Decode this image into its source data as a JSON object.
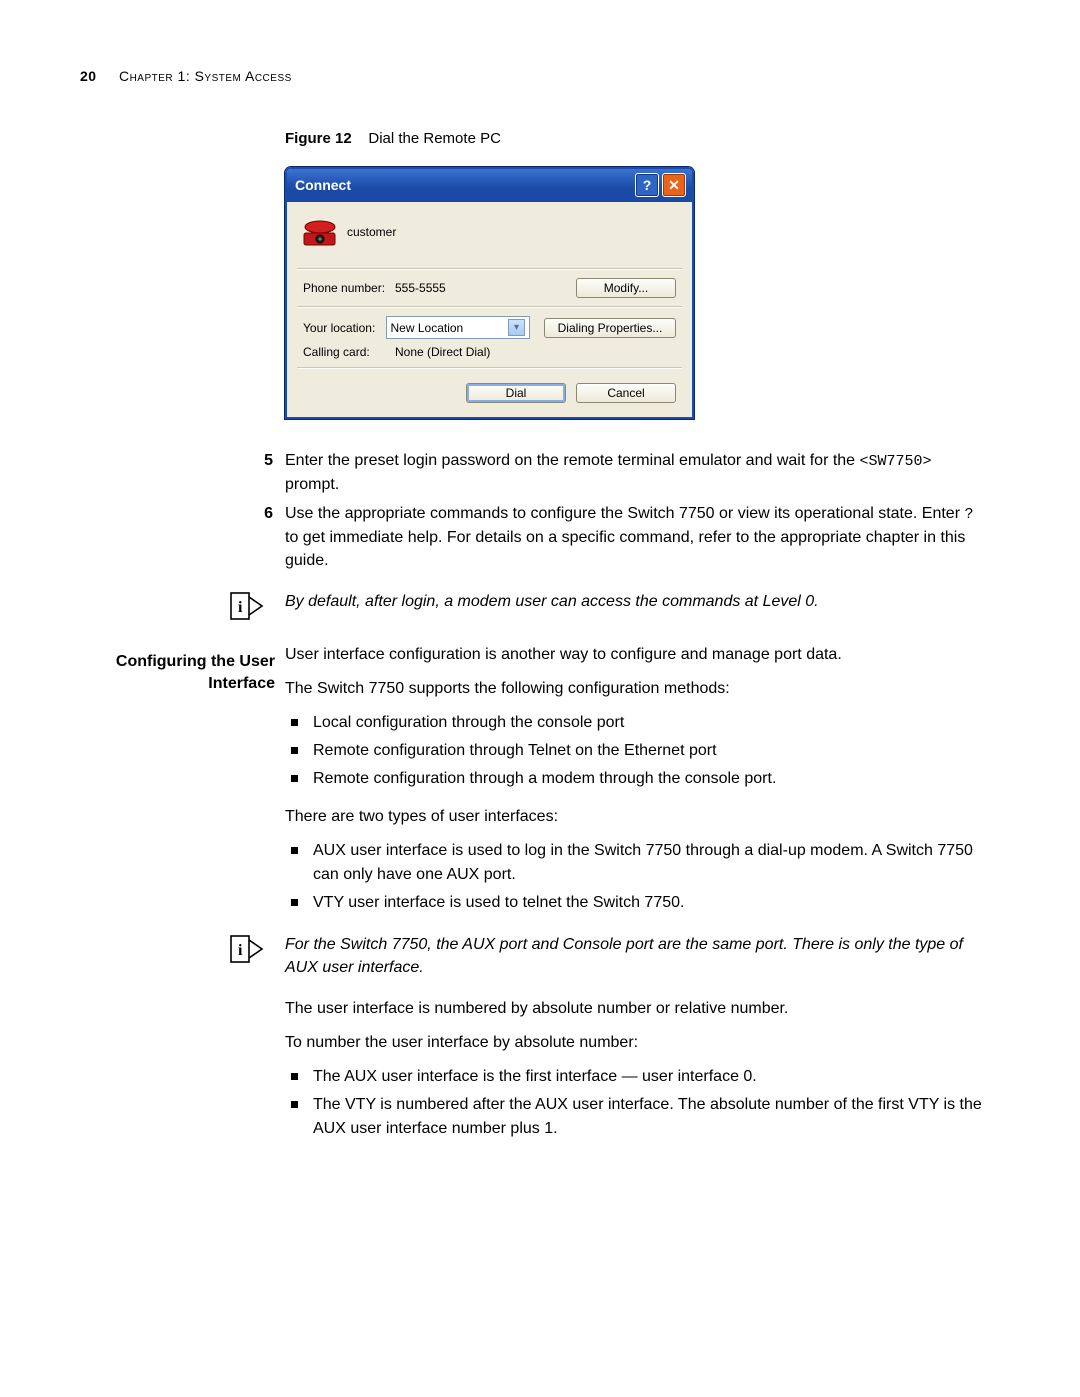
{
  "header": {
    "page_number": "20",
    "chapter": "Chapter 1: System Access"
  },
  "figure": {
    "label": "Figure 12",
    "caption": "Dial the Remote PC"
  },
  "dialog": {
    "title": "Connect",
    "help_btn": "?",
    "close_btn": "✕",
    "customer": "customer",
    "phone_label": "Phone number:",
    "phone_value": "555-5555",
    "modify_btn": "Modify...",
    "location_label": "Your location:",
    "location_value": "New Location",
    "dialing_btn": "Dialing Properties...",
    "card_label": "Calling card:",
    "card_value": "None (Direct Dial)",
    "dial_btn": "Dial",
    "cancel_btn": "Cancel"
  },
  "steps": {
    "s5_num": "5",
    "s5_a": "Enter the preset login password on the remote terminal emulator and wait for the ",
    "s5_code": "<SW7750>",
    "s5_b": " prompt.",
    "s6_num": "6",
    "s6_a": "Use the appropriate commands to configure the Switch 7750 or view its operational state. Enter ",
    "s6_code": "?",
    "s6_b": " to get immediate help. For details on a specific command, refer to the appropriate chapter in this guide."
  },
  "note1": "By default, after login, a modem user can access the commands at Level 0.",
  "section_title": "Configuring the User Interface",
  "body": {
    "p1": "User interface configuration is another way to configure and manage port data.",
    "p2": "The Switch 7750 supports the following configuration methods:",
    "l1a": "Local configuration through the console port",
    "l1b": "Remote configuration through Telnet on the Ethernet port",
    "l1c": "Remote configuration through a modem through the console port.",
    "p3": "There are two types of user interfaces:",
    "l2a": "AUX user interface is used to log in the Switch 7750 through a dial-up modem. A Switch 7750 can only have one AUX port.",
    "l2b": "VTY user interface is used to telnet the Switch 7750.",
    "note2": "For the Switch 7750, the AUX port and Console port are the same port. There is only the type of AUX user interface.",
    "p4": "The user interface is numbered by absolute number or relative number.",
    "p5": "To number the user interface by absolute number:",
    "l3a": "The AUX user interface is the first interface — user interface 0.",
    "l3b": "The VTY is numbered after the AUX user interface. The absolute number of the first VTY is the AUX user interface number plus 1."
  }
}
